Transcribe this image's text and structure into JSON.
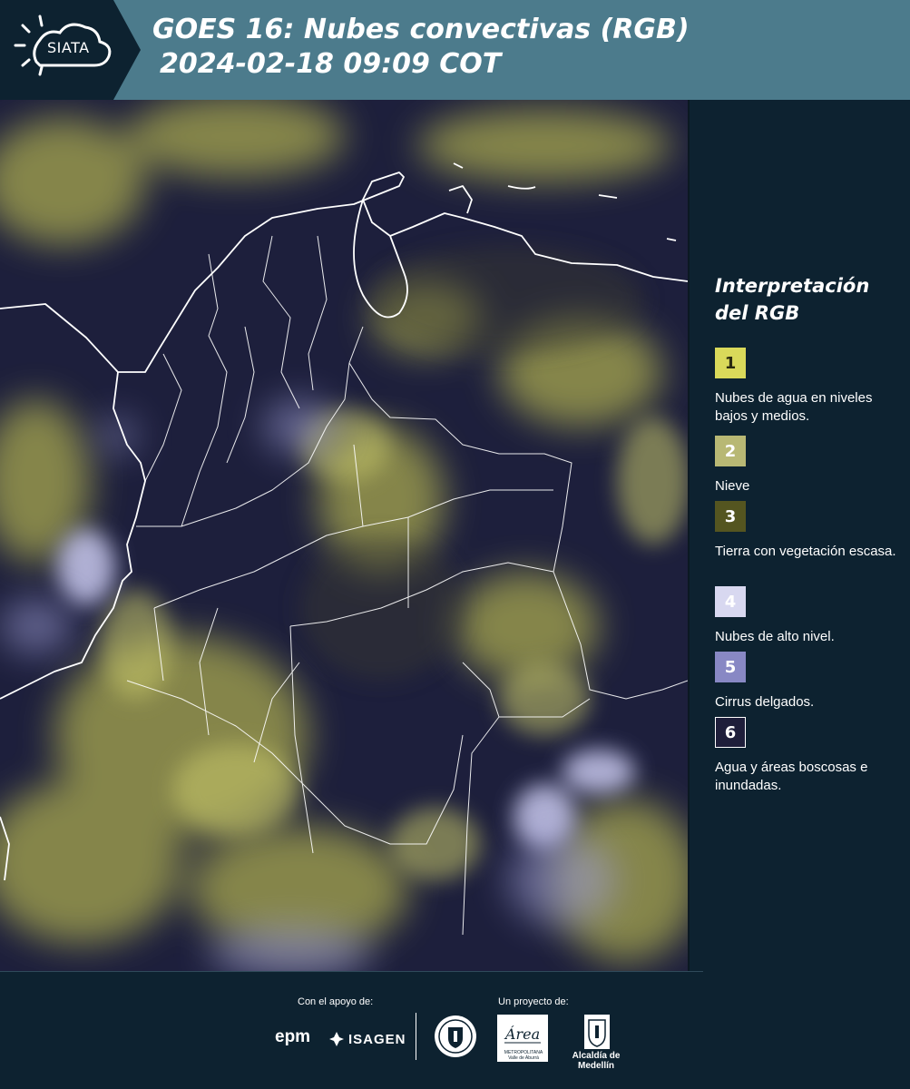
{
  "header": {
    "logo_text": "SIATA",
    "title_line1": "GOES 16: Nubes convectivas (RGB)",
    "title_line2": "2024-02-18 09:09 COT",
    "background_color": "#4c7b8c"
  },
  "legend": {
    "title": "Interpretación del RGB",
    "items": [
      {
        "number": "1",
        "label": "Nubes de agua en niveles bajos y medios.",
        "color": "#d9d95a",
        "text_color": "#2a2a10"
      },
      {
        "number": "2",
        "label": "Nieve",
        "color": "#b8b874",
        "text_color": "#ffffff"
      },
      {
        "number": "3",
        "label": "Tierra con vegetación escasa.",
        "color": "#545520",
        "text_color": "#ffffff"
      },
      {
        "number": "4",
        "label": "Nubes de alto nivel.",
        "color": "#d8d8f0",
        "text_color": "#ffffff"
      },
      {
        "number": "5",
        "label": "Cirrus delgados.",
        "color": "#8888c4",
        "text_color": "#ffffff"
      },
      {
        "number": "6",
        "label": "Agua y áreas boscosas e inundadas.",
        "color": "#1e1e3a",
        "text_color": "#ffffff"
      }
    ]
  },
  "footer": {
    "support_label": "Con el apoyo de:",
    "project_label": "Un proyecto de:",
    "epm": "epm",
    "isagen": "ISAGEN",
    "area_logo_text": "Área",
    "area_subtitle": "METROPOLITANA Valle de Aburrá",
    "alcaldia": "Alcaldía de Medellín"
  }
}
